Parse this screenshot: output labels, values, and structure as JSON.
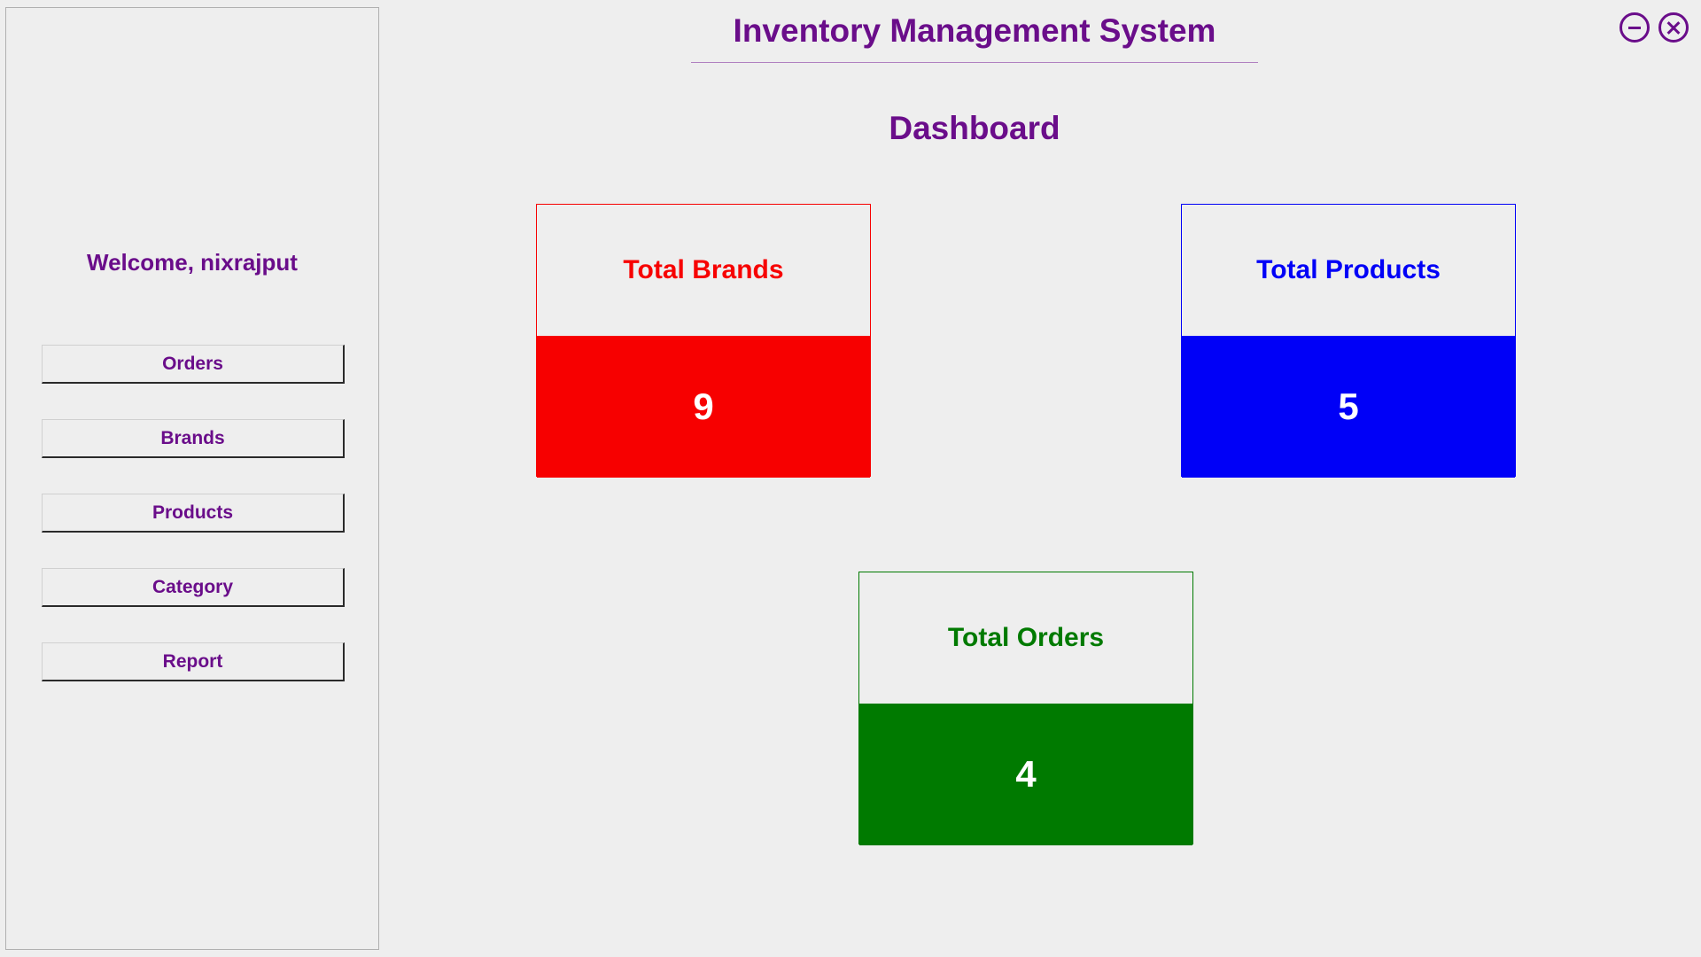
{
  "app_title": "Inventory Management System",
  "page_title": "Dashboard",
  "sidebar": {
    "welcome": "Welcome, nixrajput",
    "items": [
      {
        "label": "Orders"
      },
      {
        "label": "Brands"
      },
      {
        "label": "Products"
      },
      {
        "label": "Category"
      },
      {
        "label": "Report"
      }
    ]
  },
  "dashboard": {
    "brands_card": {
      "title": "Total Brands",
      "value": "9"
    },
    "products_card": {
      "title": "Total Products",
      "value": "5"
    },
    "orders_card": {
      "title": "Total Orders",
      "value": "4"
    }
  },
  "colors": {
    "accent": "#6a0d8a",
    "brands": "#f70000",
    "products": "#0000f7",
    "orders": "#007a00"
  }
}
